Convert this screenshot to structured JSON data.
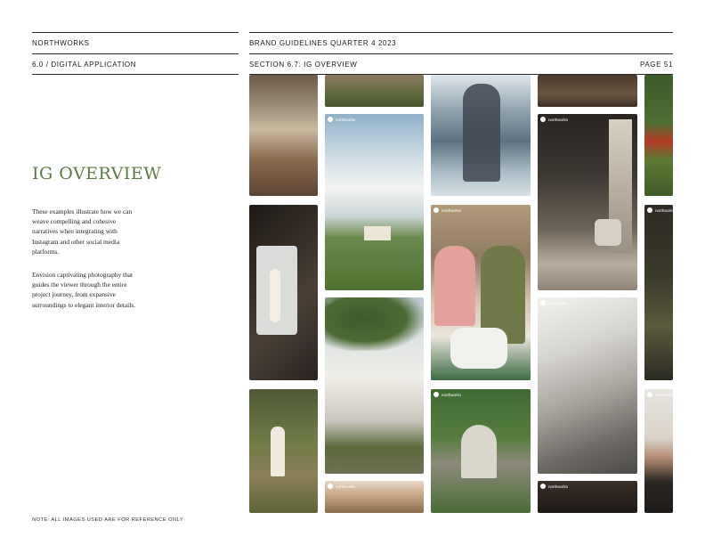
{
  "header": {
    "brand": "NORTHWORKS",
    "doc_title": "BRAND GUIDELINES QUARTER 4 2023",
    "section_left": "6.0 / DIGITAL APPLICATION",
    "section_right": "SECTION 6.7: IG OVERVIEW",
    "page": "PAGE 51"
  },
  "content": {
    "title": "IG OVERVIEW",
    "paragraph_1": "These examples illustrate how we can weave compelling and cohesive narratives when integrating with Instagram and other social media platforms.",
    "paragraph_2": "Envision captivating photography that guides the viewer through the entire project journey, from expansive surroundings to elegant interior details."
  },
  "footer": {
    "note": "NOTE: ALL IMAGES USED ARE FOR REFERENCE ONLY"
  },
  "collage": {
    "handle": "northworks"
  },
  "colors": {
    "title_green": "#5d7a45",
    "rule": "#2a2a2a"
  }
}
